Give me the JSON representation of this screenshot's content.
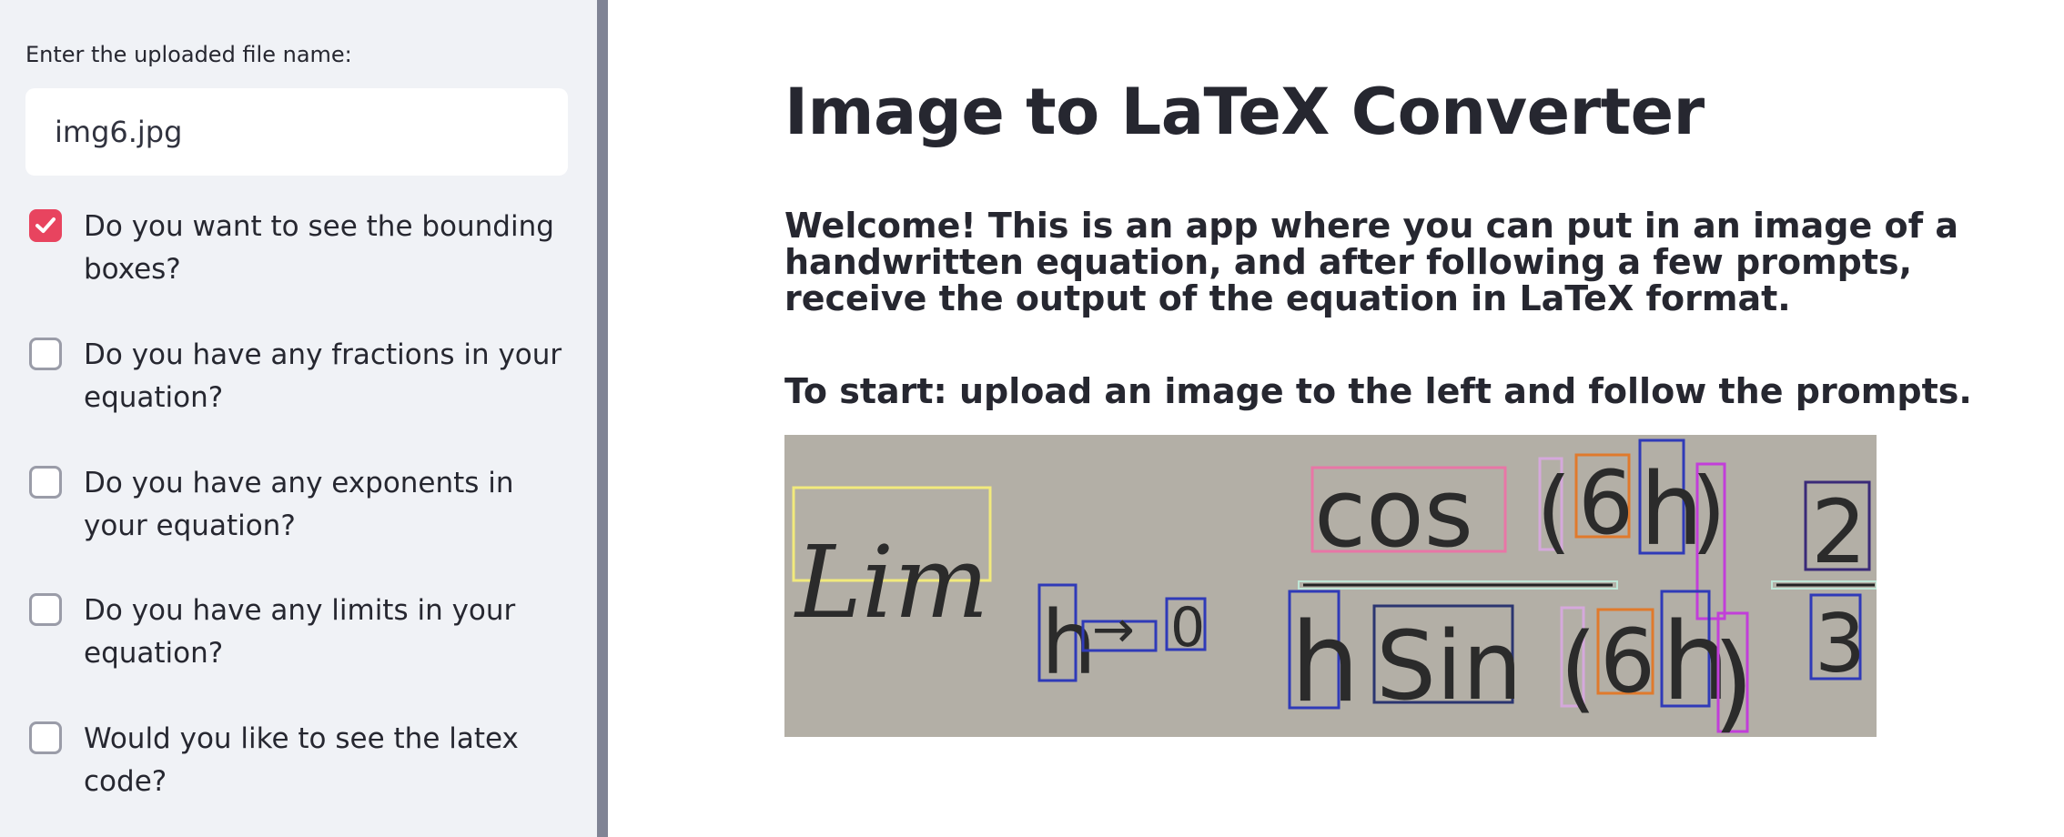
{
  "sidebar": {
    "file_input": {
      "label": "Enter the uploaded file name:",
      "value": "img6.jpg"
    },
    "checkboxes": [
      {
        "label": "Do you want to see the bounding boxes?",
        "checked": true
      },
      {
        "label": "Do you have any fractions in your equation?",
        "checked": false
      },
      {
        "label": "Do you have any exponents in your equation?",
        "checked": false
      },
      {
        "label": "Do you have any limits in your equation?",
        "checked": false
      },
      {
        "label": "Would you like to see the latex code?",
        "checked": false
      }
    ]
  },
  "main": {
    "title": "Image to LaTeX Converter",
    "welcome": "Welcome! This is an app where you can put in an image of a handwritten equation, and after following a few prompts, receive the output of the equation in LaTeX format.",
    "instruction": "To start: upload an image to the left and follow the prompts.",
    "image": {
      "symbols_top": [
        "Lim",
        "h",
        "→",
        "0",
        "cos",
        "(",
        "6",
        "h",
        ")",
        "2"
      ],
      "symbols_bottom": [
        "h",
        "Sin",
        "(",
        "6",
        "h",
        ")",
        "3"
      ]
    }
  },
  "colors": {
    "accent": "#e8445f",
    "sidebar_bg": "#f0f2f6",
    "text": "#262730",
    "image_bg": "#b3afa6"
  }
}
